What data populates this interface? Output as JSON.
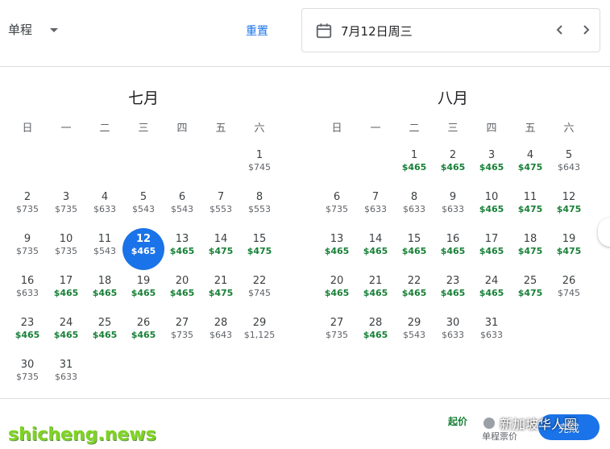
{
  "header": {
    "trip_type": "单程",
    "reset_label": "重置",
    "selected_date": "7月12日周三",
    "prev_icon": "chevron-left-icon",
    "next_icon": "chevron-right-icon"
  },
  "weekdays": [
    "日",
    "一",
    "二",
    "三",
    "四",
    "五",
    "六"
  ],
  "months": [
    {
      "title": "七月",
      "offset": 6,
      "days": [
        {
          "d": "1",
          "p": "$745",
          "low": false
        },
        {
          "d": "2",
          "p": "$735",
          "low": false
        },
        {
          "d": "3",
          "p": "$735",
          "low": false
        },
        {
          "d": "4",
          "p": "$633",
          "low": false
        },
        {
          "d": "5",
          "p": "$543",
          "low": false
        },
        {
          "d": "6",
          "p": "$543",
          "low": false
        },
        {
          "d": "7",
          "p": "$553",
          "low": false
        },
        {
          "d": "8",
          "p": "$553",
          "low": false
        },
        {
          "d": "9",
          "p": "$735",
          "low": false
        },
        {
          "d": "10",
          "p": "$735",
          "low": false
        },
        {
          "d": "11",
          "p": "$543",
          "low": false
        },
        {
          "d": "12",
          "p": "$465",
          "low": true,
          "selected": true
        },
        {
          "d": "13",
          "p": "$465",
          "low": true
        },
        {
          "d": "14",
          "p": "$475",
          "low": true
        },
        {
          "d": "15",
          "p": "$475",
          "low": true
        },
        {
          "d": "16",
          "p": "$633",
          "low": false
        },
        {
          "d": "17",
          "p": "$465",
          "low": true
        },
        {
          "d": "18",
          "p": "$465",
          "low": true
        },
        {
          "d": "19",
          "p": "$465",
          "low": true
        },
        {
          "d": "20",
          "p": "$465",
          "low": true
        },
        {
          "d": "21",
          "p": "$475",
          "low": true
        },
        {
          "d": "22",
          "p": "$745",
          "low": false
        },
        {
          "d": "23",
          "p": "$465",
          "low": true
        },
        {
          "d": "24",
          "p": "$465",
          "low": true
        },
        {
          "d": "25",
          "p": "$465",
          "low": true
        },
        {
          "d": "26",
          "p": "$465",
          "low": true
        },
        {
          "d": "27",
          "p": "$735",
          "low": false
        },
        {
          "d": "28",
          "p": "$643",
          "low": false
        },
        {
          "d": "29",
          "p": "$1,125",
          "low": false
        },
        {
          "d": "30",
          "p": "$735",
          "low": false
        },
        {
          "d": "31",
          "p": "$633",
          "low": false
        }
      ]
    },
    {
      "title": "八月",
      "offset": 2,
      "days": [
        {
          "d": "1",
          "p": "$465",
          "low": true
        },
        {
          "d": "2",
          "p": "$465",
          "low": true
        },
        {
          "d": "3",
          "p": "$465",
          "low": true
        },
        {
          "d": "4",
          "p": "$475",
          "low": true
        },
        {
          "d": "5",
          "p": "$643",
          "low": false
        },
        {
          "d": "6",
          "p": "$735",
          "low": false
        },
        {
          "d": "7",
          "p": "$633",
          "low": false
        },
        {
          "d": "8",
          "p": "$633",
          "low": false
        },
        {
          "d": "9",
          "p": "$633",
          "low": false
        },
        {
          "d": "10",
          "p": "$465",
          "low": true
        },
        {
          "d": "11",
          "p": "$475",
          "low": true
        },
        {
          "d": "12",
          "p": "$475",
          "low": true
        },
        {
          "d": "13",
          "p": "$465",
          "low": true
        },
        {
          "d": "14",
          "p": "$465",
          "low": true
        },
        {
          "d": "15",
          "p": "$465",
          "low": true
        },
        {
          "d": "16",
          "p": "$465",
          "low": true
        },
        {
          "d": "17",
          "p": "$465",
          "low": true
        },
        {
          "d": "18",
          "p": "$475",
          "low": true
        },
        {
          "d": "19",
          "p": "$475",
          "low": true
        },
        {
          "d": "20",
          "p": "$465",
          "low": true
        },
        {
          "d": "21",
          "p": "$465",
          "low": true
        },
        {
          "d": "22",
          "p": "$465",
          "low": true
        },
        {
          "d": "23",
          "p": "$465",
          "low": true
        },
        {
          "d": "24",
          "p": "$465",
          "low": true
        },
        {
          "d": "25",
          "p": "$475",
          "low": true
        },
        {
          "d": "26",
          "p": "$745",
          "low": false
        },
        {
          "d": "27",
          "p": "$735",
          "low": false
        },
        {
          "d": "28",
          "p": "$465",
          "low": true
        },
        {
          "d": "29",
          "p": "$543",
          "low": false
        },
        {
          "d": "30",
          "p": "$633",
          "low": false
        },
        {
          "d": "31",
          "p": "$633",
          "low": false
        }
      ]
    }
  ],
  "footer": {
    "from_label": "起价",
    "price_note": "单程票价",
    "done_label": "完成",
    "overlay_text": "新加坡华人圈",
    "watermark": "shicheng.news"
  },
  "colors": {
    "accent": "#1a73e8",
    "low_price": "#188038",
    "normal_price": "#5f6368"
  }
}
